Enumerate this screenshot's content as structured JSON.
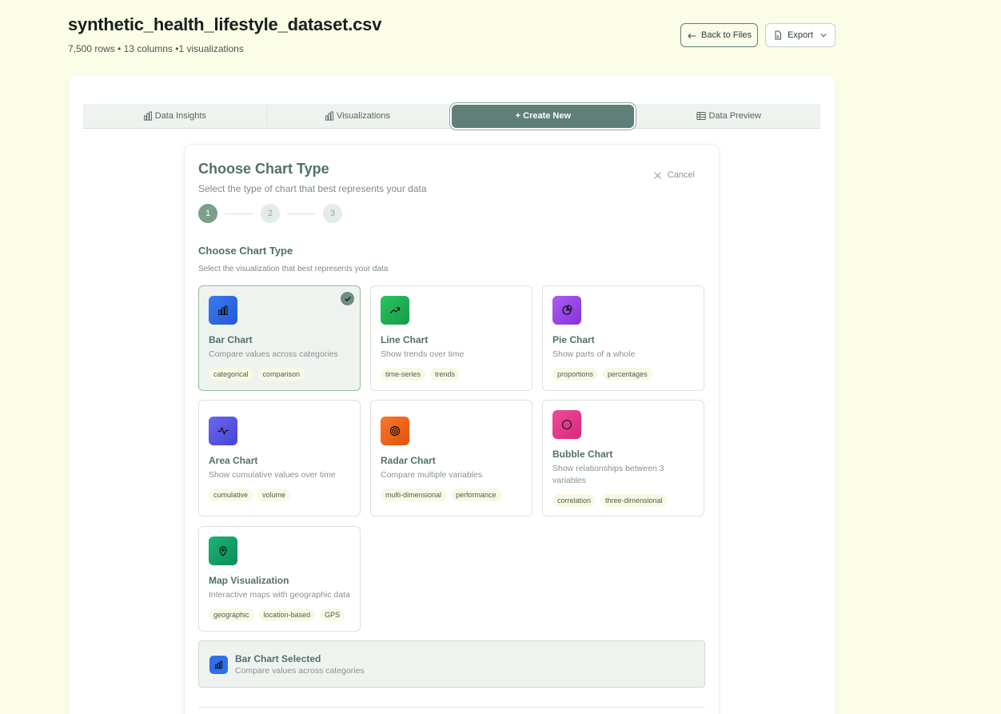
{
  "header": {
    "file_name": "synthetic_health_lifestyle_dataset.csv",
    "meta": "7,500 rows • 13 columns •1 visualizations",
    "back_label": "Back to Files",
    "export_label": "Export"
  },
  "tabs": [
    {
      "label": "Data Insights",
      "icon": "bar-chart-icon"
    },
    {
      "label": "Visualizations",
      "icon": "bar-chart-icon"
    },
    {
      "label": "+ Create New",
      "icon": "plus-icon",
      "active": true
    },
    {
      "label": "Data Preview",
      "icon": "table-icon"
    }
  ],
  "wizard": {
    "title": "Choose Chart Type",
    "subtitle": "Select the type of chart that best represents your data",
    "cancel_label": "Cancel",
    "steps": [
      "1",
      "2",
      "3"
    ],
    "current_step": 1,
    "section_title": "Choose Chart Type",
    "section_subtitle": "Select the visualization that best represents your data",
    "chart_types": [
      {
        "name": "Bar Chart",
        "description": "Compare values across categories",
        "tags": [
          "categorical",
          "comparison"
        ],
        "icon": "bar-chart-icon",
        "color": "#2f6fea",
        "selected": true
      },
      {
        "name": "Line Chart",
        "description": "Show trends over time",
        "tags": [
          "time-series",
          "trends"
        ],
        "icon": "trending-up-icon",
        "color": "#22b455"
      },
      {
        "name": "Pie Chart",
        "description": "Show parts of a whole",
        "tags": [
          "proportions",
          "percentages"
        ],
        "icon": "pie-chart-icon",
        "color": "#9b4ce8"
      },
      {
        "name": "Area Chart",
        "description": "Show cumulative values over time",
        "tags": [
          "cumulative",
          "volume"
        ],
        "icon": "activity-icon",
        "color": "#5a57e6"
      },
      {
        "name": "Radar Chart",
        "description": "Compare multiple variables",
        "tags": [
          "multi-dimensional",
          "performance"
        ],
        "icon": "target-icon",
        "color": "#f06414"
      },
      {
        "name": "Bubble Chart",
        "description": "Show relationships between 3 variables",
        "tags": [
          "correlation",
          "three-dimensional"
        ],
        "icon": "circle-icon",
        "color": "#e23c8c"
      },
      {
        "name": "Map Visualization",
        "description": "Interactive maps with geographic data",
        "tags": [
          "geographic",
          "location-based",
          "GPS"
        ],
        "icon": "map-pin-icon",
        "color": "#11a36a"
      }
    ],
    "selected_banner": {
      "title": "Bar Chart Selected",
      "description": "Compare values across categories"
    }
  }
}
